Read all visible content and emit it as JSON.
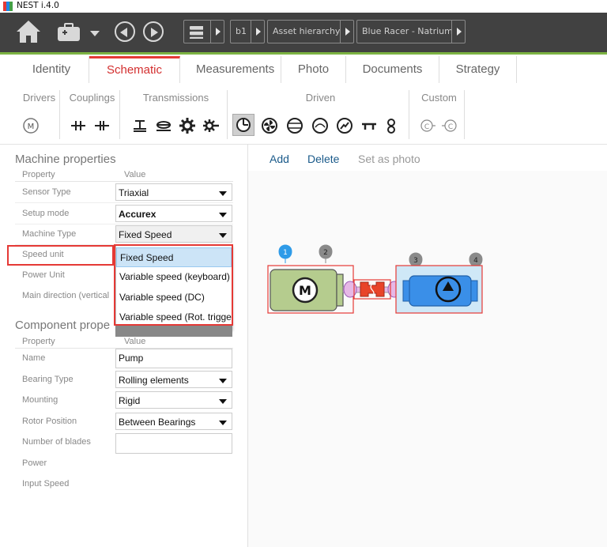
{
  "window": {
    "title": "NEST i.4.0"
  },
  "toolbar": {
    "breadcrumbs": [
      "b1",
      "Asset hierarchy",
      "Blue Racer - Natrium"
    ]
  },
  "tabs": [
    "Identity",
    "Schematic",
    "Measurements",
    "Photo",
    "Documents",
    "Strategy"
  ],
  "active_tab": "Schematic",
  "palette": {
    "groups": [
      {
        "title": "Drivers"
      },
      {
        "title": "Couplings"
      },
      {
        "title": "Transmissions"
      },
      {
        "title": "Driven"
      },
      {
        "title": "Custom"
      }
    ]
  },
  "machine_properties": {
    "title": "Machine properties",
    "col_property": "Property",
    "col_value": "Value",
    "rows": [
      {
        "label": "Sensor Type",
        "value": "Triaxial"
      },
      {
        "label": "Setup mode",
        "value": "Accurex"
      },
      {
        "label": "Machine Type",
        "value": "Fixed Speed"
      },
      {
        "label": "Speed unit",
        "value": ""
      },
      {
        "label": "Power Unit",
        "value": ""
      },
      {
        "label": "Main direction (vertical",
        "value": ""
      }
    ]
  },
  "machine_type_dropdown": {
    "options": [
      "Fixed Speed",
      "Variable speed (keyboard)",
      "Variable speed (DC)",
      "Variable speed (Rot. trigger"
    ]
  },
  "component_properties": {
    "title": "Component prope",
    "col_property": "Property",
    "col_value": "Value",
    "rows": [
      {
        "label": "Name",
        "value": "Pump"
      },
      {
        "label": "Bearing Type",
        "value": "Rolling elements"
      },
      {
        "label": "Mounting",
        "value": "Rigid"
      },
      {
        "label": "Rotor Position",
        "value": "Between Bearings"
      },
      {
        "label": "Number of blades",
        "value": ""
      },
      {
        "label": "Power",
        "value": ""
      },
      {
        "label": "Input Speed",
        "value": ""
      }
    ]
  },
  "canvas": {
    "actions": {
      "add": "Add",
      "delete": "Delete",
      "set_photo": "Set as photo"
    },
    "markers": [
      "1",
      "2",
      "3",
      "4"
    ],
    "motor_label": "M"
  },
  "colors": {
    "toolbar_bg": "#414141",
    "accent_green": "#7cb342",
    "active_tab": "#e53935",
    "motor_fill": "#b5cc8e",
    "pump_fill": "#3a8fe8",
    "coupling": "#e8442a",
    "highlight": "#e53935"
  }
}
